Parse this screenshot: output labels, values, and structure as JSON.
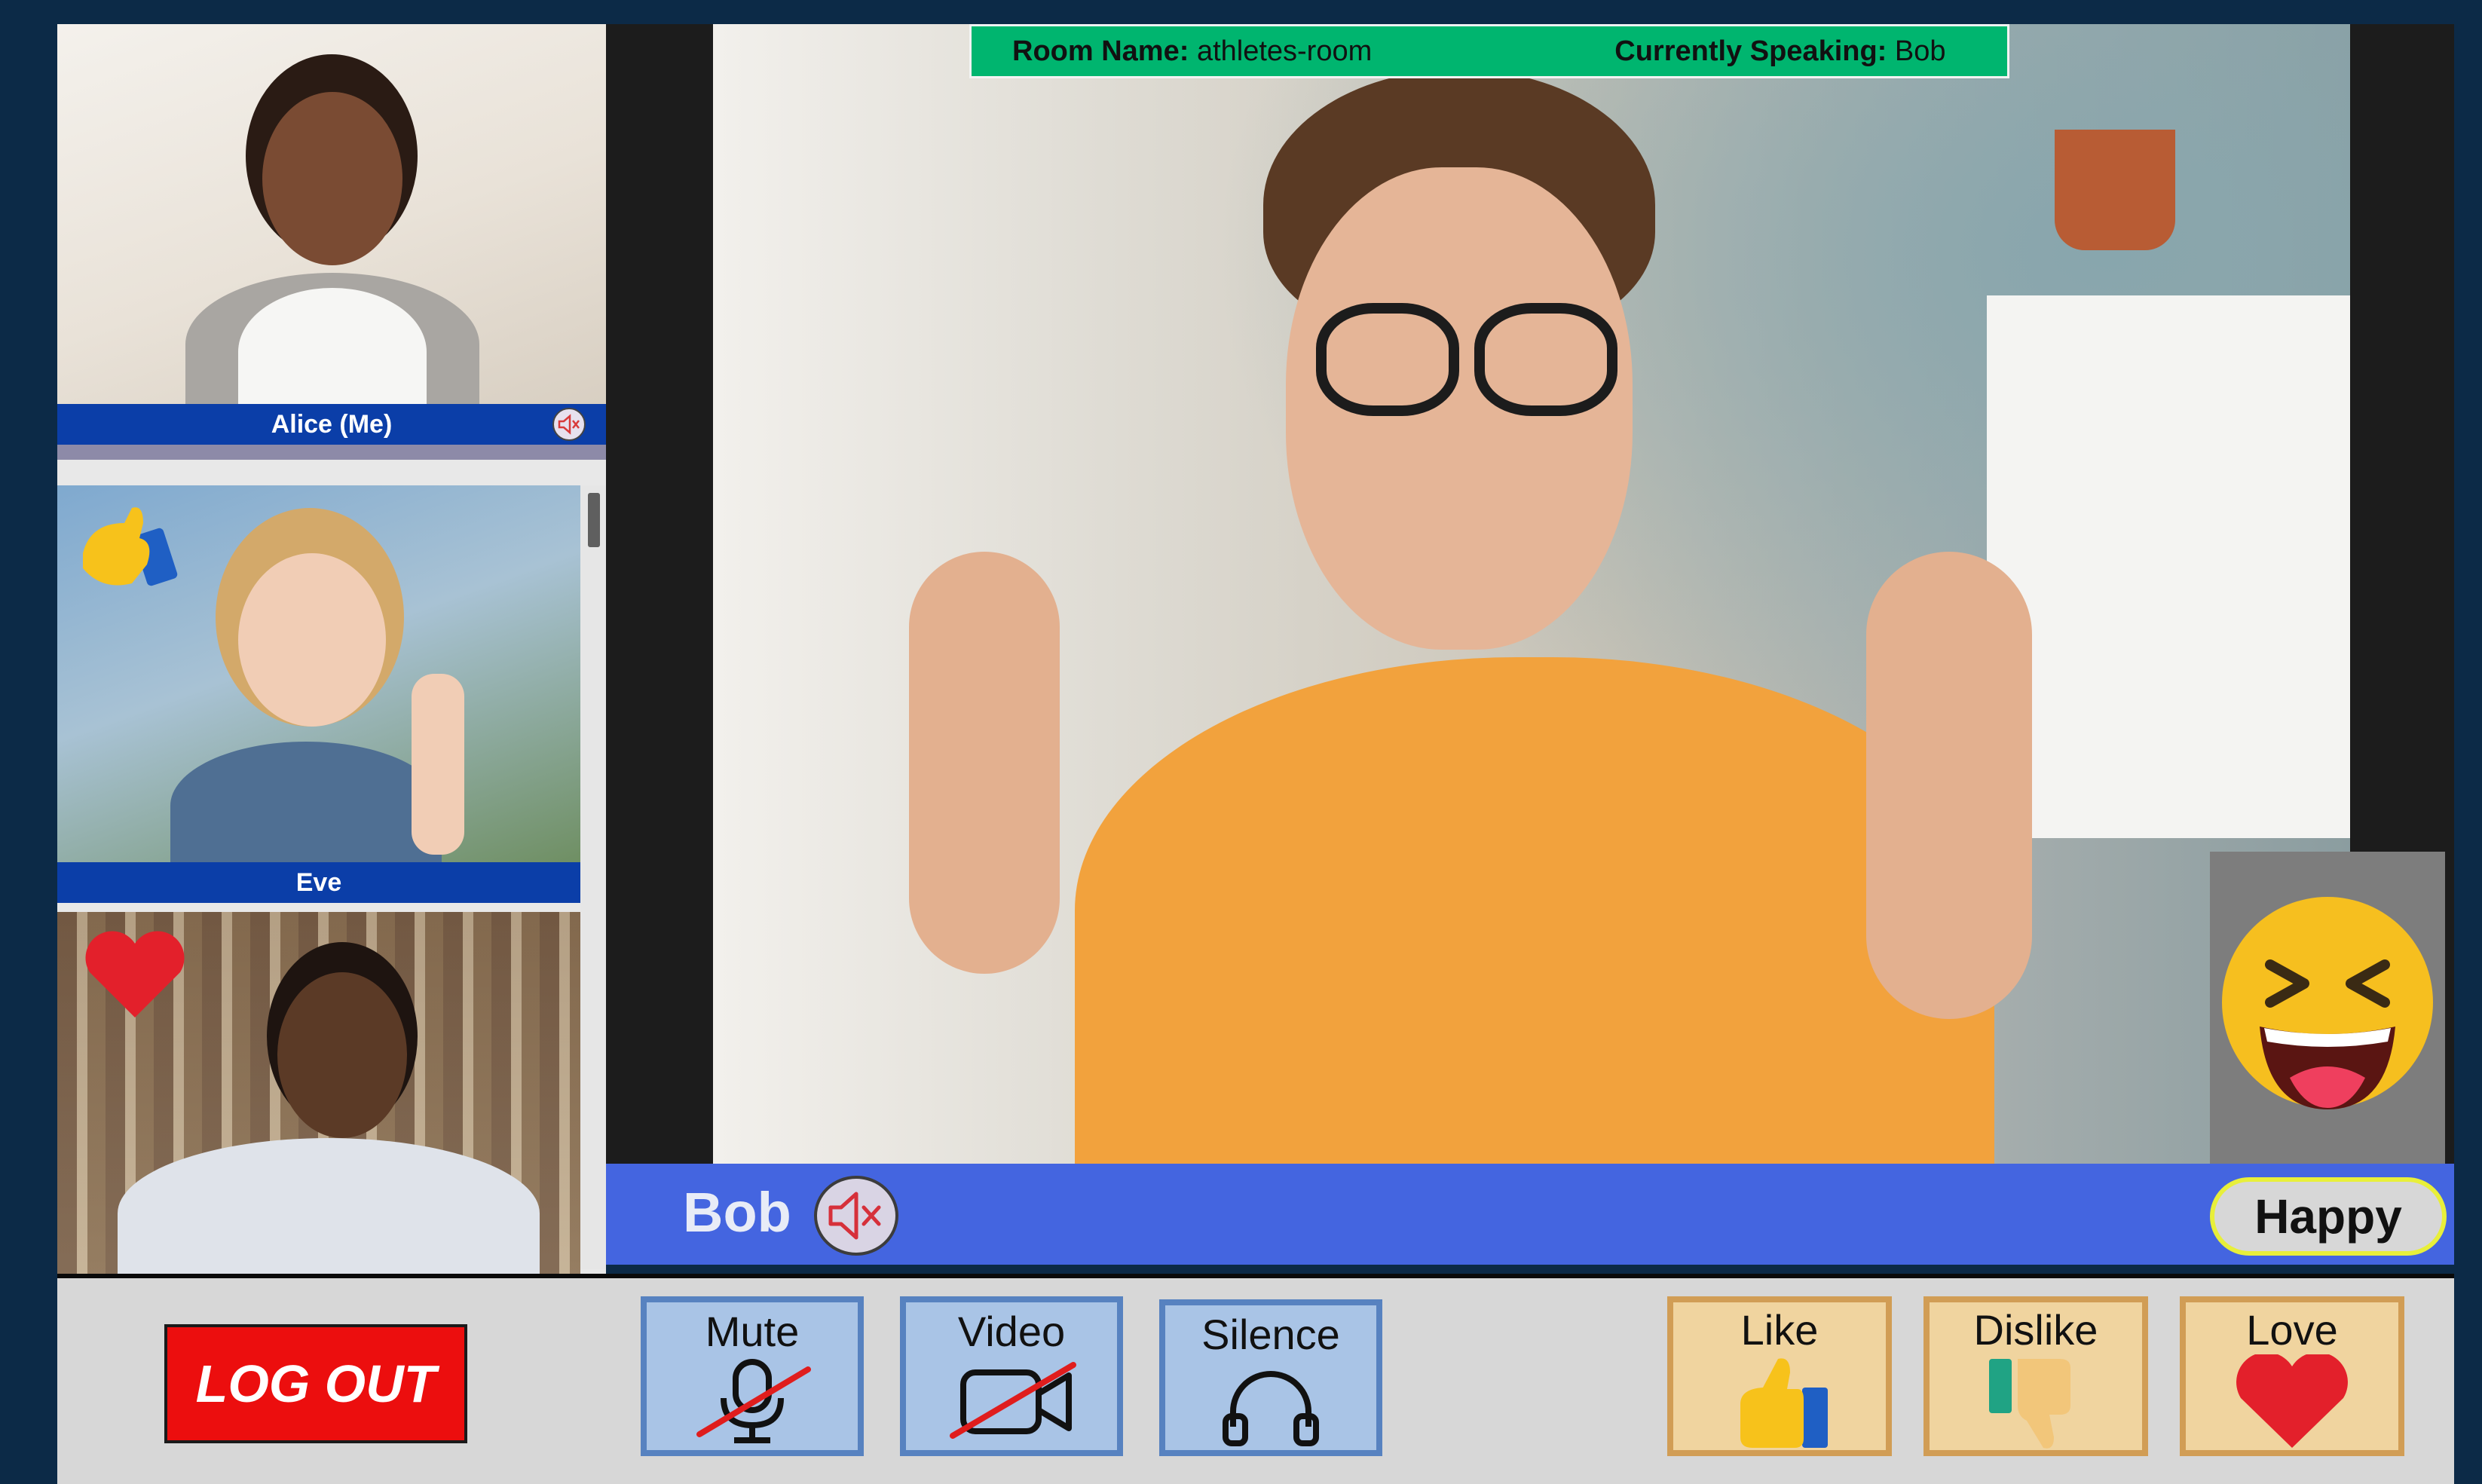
{
  "room": {
    "name_label": "Room Name:",
    "name_value": "athletes-room",
    "speaking_label": "Currently Speaking:",
    "speaking_value": "Bob"
  },
  "participants": [
    {
      "name": "Alice (Me)",
      "muted": true,
      "reaction": "none"
    },
    {
      "name": "Eve",
      "muted": false,
      "reaction": "like"
    },
    {
      "name": "",
      "muted": false,
      "reaction": "love"
    }
  ],
  "main_speaker": {
    "name": "Bob",
    "muted": true,
    "mood": "Happy",
    "mood_emoji": "laughing-face-icon"
  },
  "controls": {
    "logout_label": "LOG OUT",
    "mute_label": "Mute",
    "video_label": "Video",
    "silence_label": "Silence"
  },
  "reactions": {
    "like_label": "Like",
    "dislike_label": "Dislike",
    "love_label": "Love"
  },
  "colors": {
    "room_bar": "#00b56f",
    "nameplate": "#0b3ea8",
    "speaker_bar": "#4465e0",
    "logout": "#ec0e0e",
    "control_button": "#a9c4e6",
    "reaction_button": "#f0d49f"
  }
}
